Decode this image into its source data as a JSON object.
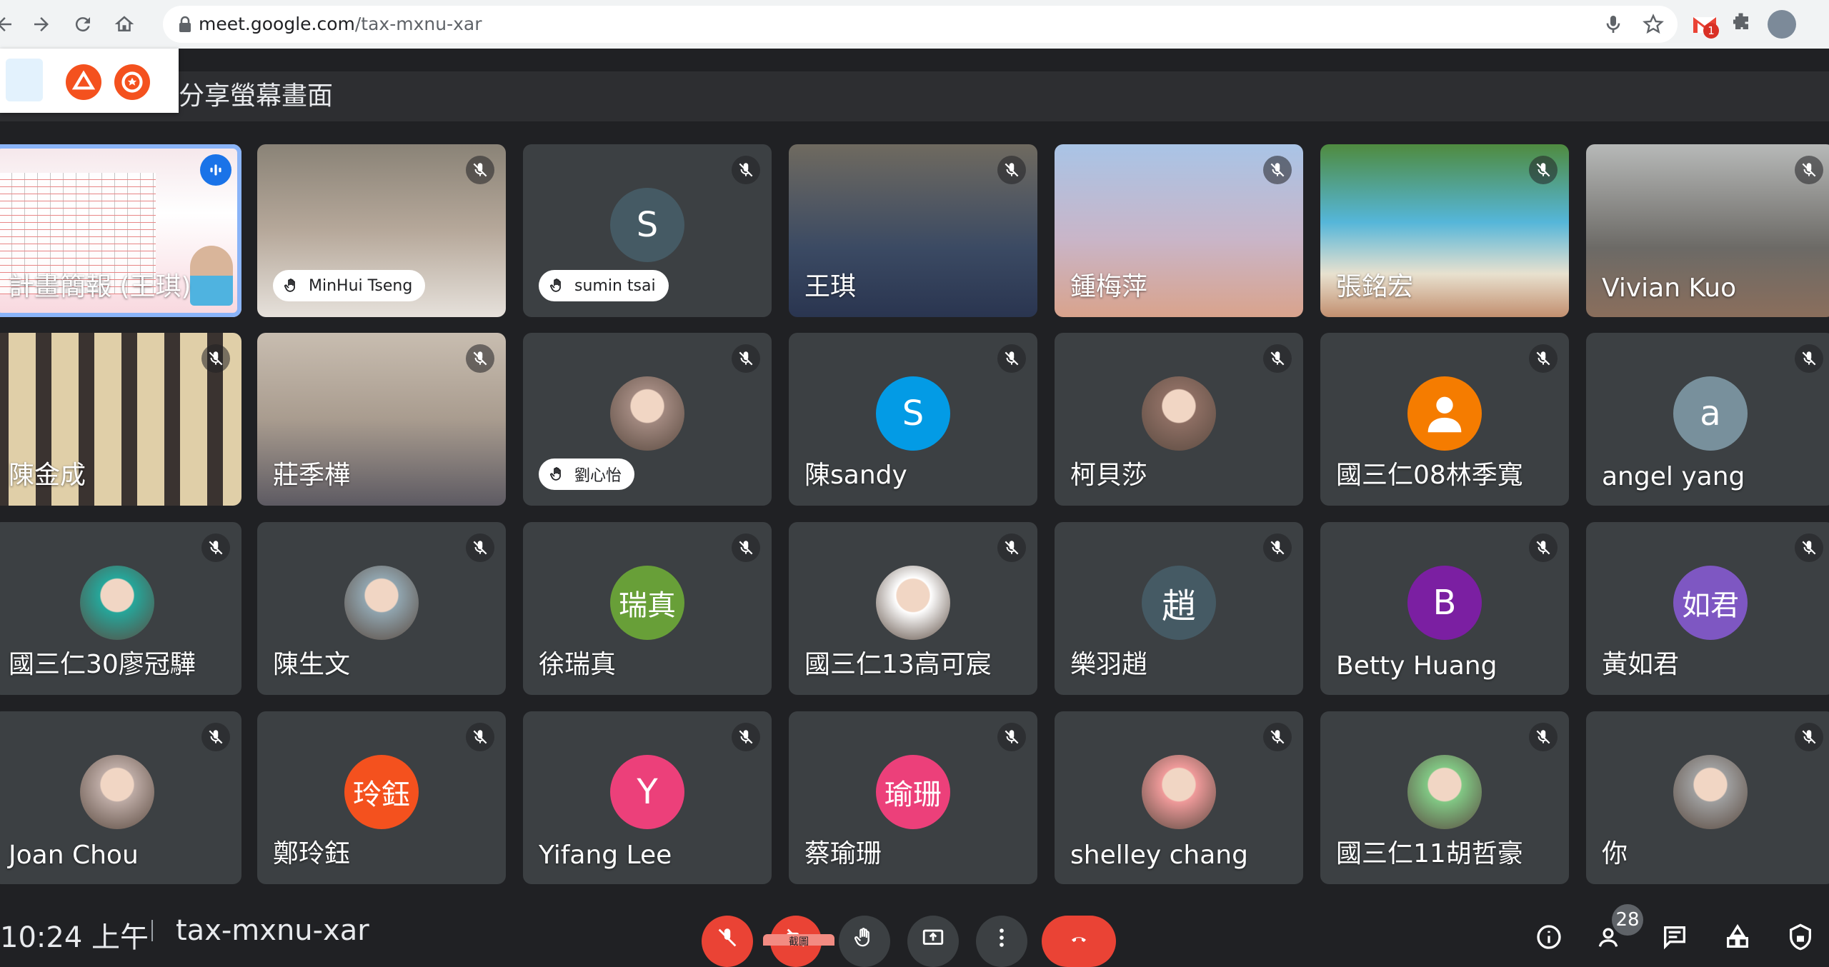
{
  "browser": {
    "url_host": "meet.google.com",
    "url_path": "/tax-mxnu-xar",
    "gmail_badge": "1"
  },
  "presenting": {
    "label": "分享螢幕畫面"
  },
  "tiles": [
    {
      "name": "計畫簡報 (王琪)",
      "kind": "screen"
    },
    {
      "name": "MinHui Tseng",
      "kind": "video",
      "hand": true
    },
    {
      "name": "sumin tsai",
      "kind": "avatar",
      "initial": "S",
      "color": "#455a64",
      "hand": true
    },
    {
      "name": "王琪",
      "kind": "video"
    },
    {
      "name": "鍾梅萍",
      "kind": "video"
    },
    {
      "name": "張銘宏",
      "kind": "video"
    },
    {
      "name": "Vivian Kuo",
      "kind": "video"
    },
    {
      "name": "陳金成",
      "kind": "video"
    },
    {
      "name": "莊季樺",
      "kind": "video"
    },
    {
      "name": "劉心怡",
      "kind": "avatar",
      "initial": "",
      "color": "#a1887f",
      "hand": true
    },
    {
      "name": "陳sandy",
      "kind": "avatar",
      "initial": "S",
      "color": "#039be5"
    },
    {
      "name": "柯貝莎",
      "kind": "avatar",
      "initial": "",
      "color": "#8d6e63"
    },
    {
      "name": "國三仁08林季寬",
      "kind": "avatar",
      "initial": "person",
      "color": "#f57c00"
    },
    {
      "name": "angel yang",
      "kind": "avatar",
      "initial": "a",
      "color": "#78909c"
    },
    {
      "name": "國三仁30廖冠驊",
      "kind": "avatar",
      "initial": "",
      "color": "#26a69a"
    },
    {
      "name": "陳生文",
      "kind": "avatar",
      "initial": "",
      "color": "#90a4ae"
    },
    {
      "name": "徐瑞真",
      "kind": "avatar",
      "initial": "瑞真",
      "color": "#689f38"
    },
    {
      "name": "國三仁13高可宸",
      "kind": "avatar",
      "initial": "",
      "color": "#ffffff"
    },
    {
      "name": "樂羽趙",
      "kind": "avatar",
      "initial": "趙",
      "color": "#455a64"
    },
    {
      "name": "Betty Huang",
      "kind": "avatar",
      "initial": "B",
      "color": "#7b1fa2"
    },
    {
      "name": "黃如君",
      "kind": "avatar",
      "initial": "如君",
      "color": "#7e57c2"
    },
    {
      "name": "Joan Chou",
      "kind": "avatar",
      "initial": "",
      "color": "#bcaaa4"
    },
    {
      "name": "鄭玲鈺",
      "kind": "avatar",
      "initial": "玲鈺",
      "color": "#f4511e"
    },
    {
      "name": "Yifang Lee",
      "kind": "avatar",
      "initial": "Y",
      "color": "#ec407a"
    },
    {
      "name": "蔡瑜珊",
      "kind": "avatar",
      "initial": "瑜珊",
      "color": "#ec407a"
    },
    {
      "name": "shelley chang",
      "kind": "avatar",
      "initial": "",
      "color": "#ef9a9a"
    },
    {
      "name": "國三仁11胡哲豪",
      "kind": "avatar",
      "initial": "",
      "color": "#81c784"
    },
    {
      "name": "你",
      "kind": "avatar",
      "initial": "",
      "color": "#9e9e9e"
    }
  ],
  "bottom_bar": {
    "clock": "10:24 上午",
    "meeting_code": "tax-mxnu-xar",
    "participant_count": "28",
    "capture_tip": "截圖"
  },
  "colors": {
    "background": "#202124",
    "tile": "#3c4043",
    "hangup": "#ea4335",
    "active_outline": "#8ab4f8"
  }
}
